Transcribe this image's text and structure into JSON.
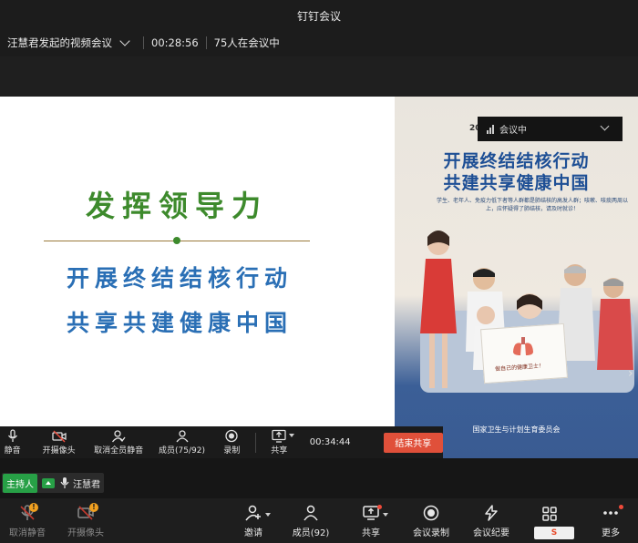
{
  "window": {
    "title": "钉钉会议"
  },
  "meeting": {
    "name": "汪慧君发起的视频会议",
    "duration": "00:28:56",
    "participants_text": "75人在会议中"
  },
  "slide": {
    "headline": "发挥领导力",
    "line1": "开展终结结核行动",
    "line2": "共享共建健康中国"
  },
  "poster": {
    "partial_text": "20",
    "title1": "开展终结结核行动",
    "title2": "共建共享健康中国",
    "subtitle": "学生、老年人、免疫力低下者等人群都是肺结核的高发人群；咳嗽、咳痰两周以上，应怀疑得了肺结核，请及时就诊！",
    "sign_text": "做自己的健康卫士！",
    "org": "国家卫生与计划生育委员会"
  },
  "status_overlay": {
    "label": "会议中"
  },
  "share_toolbar": {
    "mute": "静音",
    "camera": "开摄像头",
    "unmute_all": "取消全员静音",
    "members": "成员(75/92)",
    "record": "录制",
    "share": "共享",
    "timer": "00:34:44",
    "end_share": "结束共享"
  },
  "host": {
    "tag": "主持人",
    "name": "汪慧君"
  },
  "bottom_toolbar": {
    "unmute": "取消静音",
    "camera": "开摄像头",
    "invite": "邀请",
    "members": "成员(92)",
    "share": "共享",
    "record": "会议录制",
    "minutes": "会议纪要",
    "more": "更多"
  },
  "ime": {
    "label": "S"
  },
  "colors": {
    "accent_red": "#e0503a",
    "host_green": "#27a046",
    "warn_orange": "#f0a020",
    "slide_green": "#3d8a2c",
    "slide_blue": "#2a6fb5"
  }
}
